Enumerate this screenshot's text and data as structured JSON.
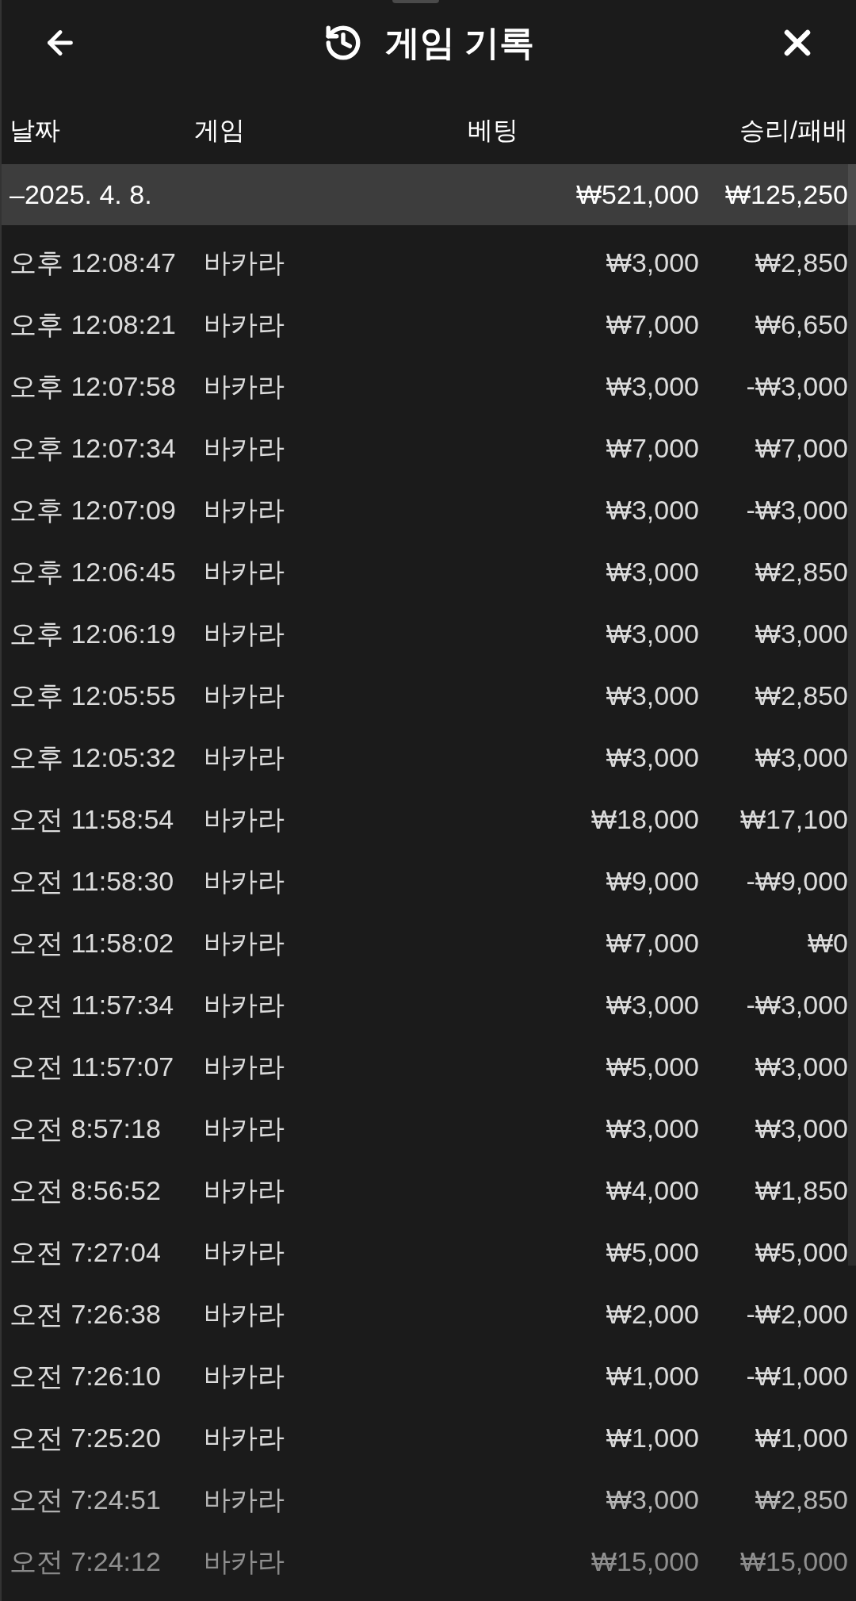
{
  "header": {
    "title": "게임 기록"
  },
  "table": {
    "columns": [
      "날짜",
      "게임",
      "베팅",
      "승리/패배"
    ],
    "group": {
      "date": "–2025. 4. 8.",
      "bet": "₩521,000",
      "result": "₩125,250"
    },
    "rows": [
      {
        "time": "오후 12:08:47",
        "game": "바카라",
        "bet": "₩3,000",
        "result": "₩2,850"
      },
      {
        "time": "오후 12:08:21",
        "game": "바카라",
        "bet": "₩7,000",
        "result": "₩6,650"
      },
      {
        "time": "오후 12:07:58",
        "game": "바카라",
        "bet": "₩3,000",
        "result": "-₩3,000"
      },
      {
        "time": "오후 12:07:34",
        "game": "바카라",
        "bet": "₩7,000",
        "result": "₩7,000"
      },
      {
        "time": "오후 12:07:09",
        "game": "바카라",
        "bet": "₩3,000",
        "result": "-₩3,000"
      },
      {
        "time": "오후 12:06:45",
        "game": "바카라",
        "bet": "₩3,000",
        "result": "₩2,850"
      },
      {
        "time": "오후 12:06:19",
        "game": "바카라",
        "bet": "₩3,000",
        "result": "₩3,000"
      },
      {
        "time": "오후 12:05:55",
        "game": "바카라",
        "bet": "₩3,000",
        "result": "₩2,850"
      },
      {
        "time": "오후 12:05:32",
        "game": "바카라",
        "bet": "₩3,000",
        "result": "₩3,000"
      },
      {
        "time": "오전 11:58:54",
        "game": "바카라",
        "bet": "₩18,000",
        "result": "₩17,100"
      },
      {
        "time": "오전 11:58:30",
        "game": "바카라",
        "bet": "₩9,000",
        "result": "-₩9,000"
      },
      {
        "time": "오전 11:58:02",
        "game": "바카라",
        "bet": "₩7,000",
        "result": "₩0"
      },
      {
        "time": "오전 11:57:34",
        "game": "바카라",
        "bet": "₩3,000",
        "result": "-₩3,000"
      },
      {
        "time": "오전 11:57:07",
        "game": "바카라",
        "bet": "₩5,000",
        "result": "₩3,000"
      },
      {
        "time": "오전 8:57:18",
        "game": "바카라",
        "bet": "₩3,000",
        "result": "₩3,000"
      },
      {
        "time": "오전 8:56:52",
        "game": "바카라",
        "bet": "₩4,000",
        "result": "₩1,850"
      },
      {
        "time": "오전 7:27:04",
        "game": "바카라",
        "bet": "₩5,000",
        "result": "₩5,000"
      },
      {
        "time": "오전 7:26:38",
        "game": "바카라",
        "bet": "₩2,000",
        "result": "-₩2,000"
      },
      {
        "time": "오전 7:26:10",
        "game": "바카라",
        "bet": "₩1,000",
        "result": "-₩1,000"
      },
      {
        "time": "오전 7:25:20",
        "game": "바카라",
        "bet": "₩1,000",
        "result": "₩1,000"
      },
      {
        "time": "오전 7:24:51",
        "game": "바카라",
        "bet": "₩3,000",
        "result": "₩2,850"
      },
      {
        "time": "오전 7:24:12",
        "game": "바카라",
        "bet": "₩15,000",
        "result": "₩15,000"
      }
    ]
  }
}
